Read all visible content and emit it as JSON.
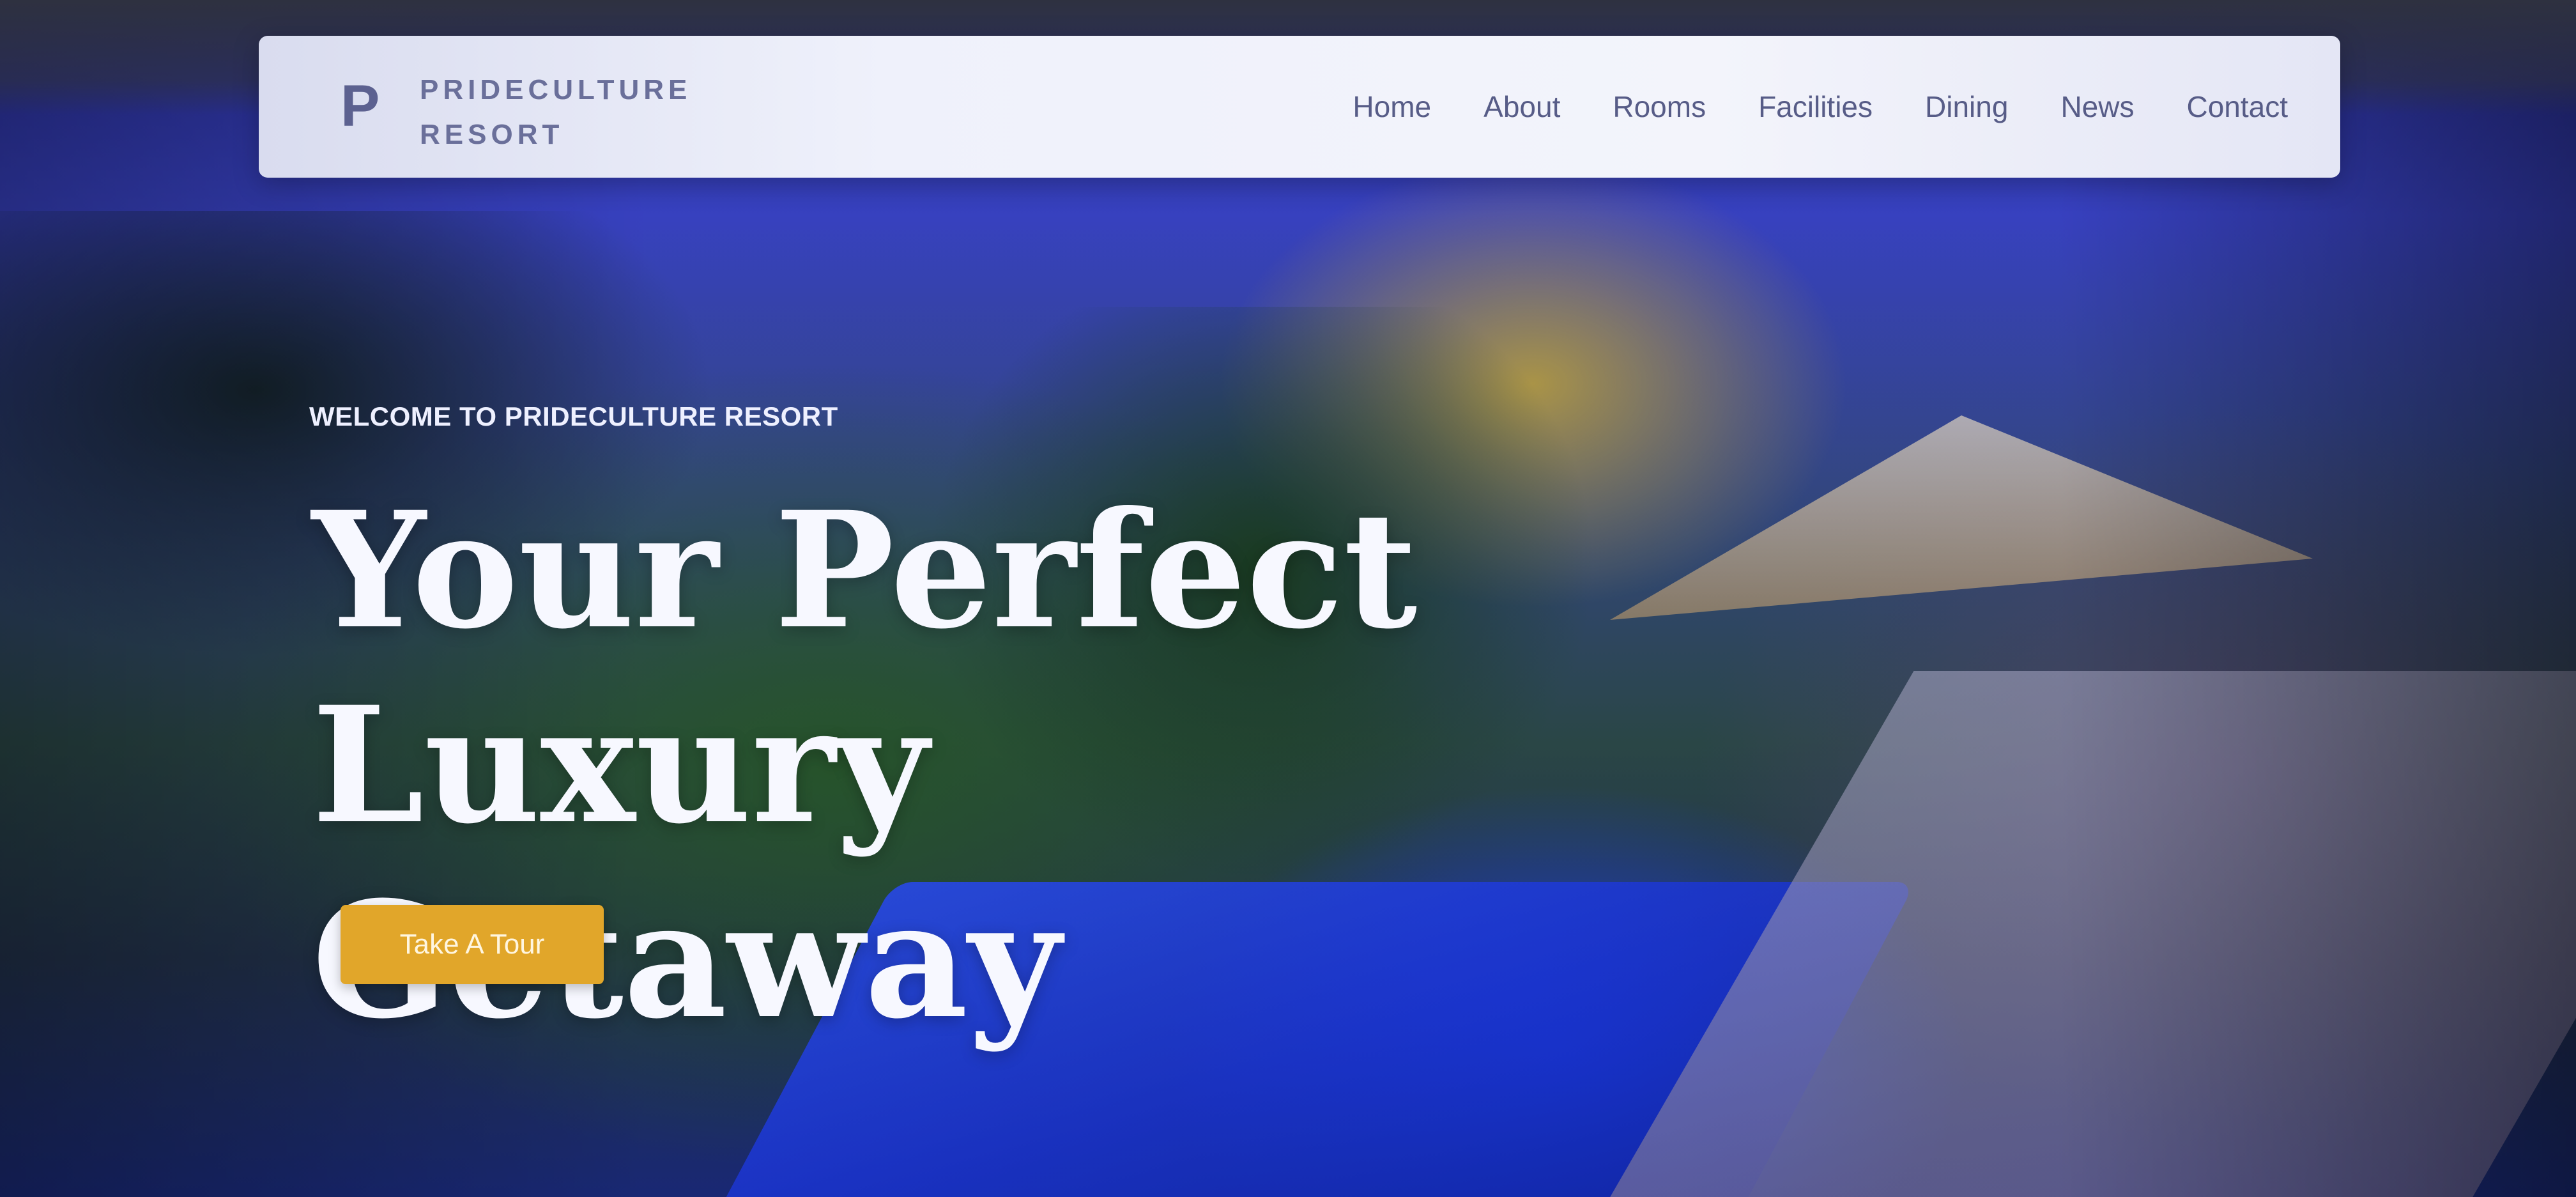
{
  "brand": {
    "logo_letter": "P",
    "name_line1": "PRIDECULTURE",
    "name_line2": "RESORT"
  },
  "nav": {
    "items": [
      {
        "label": "Home"
      },
      {
        "label": "About"
      },
      {
        "label": "Rooms"
      },
      {
        "label": "Facilities"
      },
      {
        "label": "Dining"
      },
      {
        "label": "News"
      },
      {
        "label": "Contact"
      }
    ]
  },
  "hero": {
    "eyebrow": "WELCOME TO PRIDECULTURE RESORT",
    "headline_line1": "Your Perfect",
    "headline_line2": "Luxury Getaway",
    "cta_label": "Take A Tour"
  },
  "colors": {
    "accent": "#e1a62a",
    "nav_text": "#575c87",
    "navbar_bg": "#f3f4fb",
    "headline": "#f7f8ff"
  }
}
